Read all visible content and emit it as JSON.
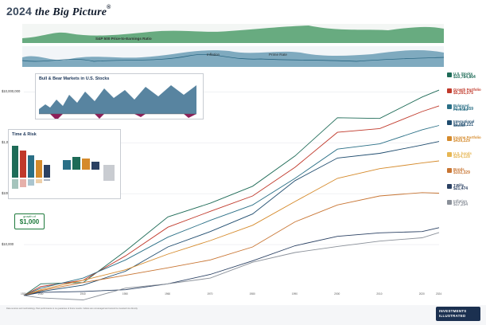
{
  "header": {
    "year": "2024",
    "brand": "the Big Picture",
    "reg": "®"
  },
  "bands": {
    "pe_title": "S&P 500 Price-to-Earnings Ratio",
    "inflation_title": "Inflation",
    "prime_title": "Prime Rate"
  },
  "y_axis": {
    "labels": [
      "$10,000,000",
      "$1,000,000",
      "$100,000",
      "$10,000"
    ]
  },
  "inset_bull": {
    "title": "Bull & Bear Markets in U.S. Stocks"
  },
  "inset_time": {
    "title": "Time & Risk"
  },
  "growth": {
    "label": "growth of",
    "value": "$1,000"
  },
  "legend": [
    {
      "name": "U.S. Stocks",
      "value": "$10,784,864",
      "color": "#1e6b57"
    },
    {
      "name": "Growth Portfolio",
      "value": "$5,291,075",
      "color": "#c0392b"
    },
    {
      "name": "Balanced Portfolio",
      "value": "$2,179,859",
      "color": "#2a6f86"
    },
    {
      "name": "International Stocks",
      "value": "$1,058,221",
      "color": "#1f4c6e"
    },
    {
      "name": "Income Portfolio",
      "value": "$439,229",
      "color": "#d58a2b"
    },
    {
      "name": "U.S. bonds",
      "value": "$254,128",
      "color": "#e6b653"
    },
    {
      "name": "Bonds",
      "value": "$102,329",
      "color": "#c87533"
    },
    {
      "name": "T-Bills",
      "value": "$21,474",
      "color": "#2b4163"
    },
    {
      "name": "Inflation",
      "value": "$17,254",
      "color": "#8a9099"
    }
  ],
  "logo": {
    "line1": "INVESTMENTS",
    "line2": "ILLUSTRATED"
  },
  "footnote": "Data sources and methodology. Past performance is no guarantee of future results. Indices are unmanaged and cannot be invested into directly.",
  "x_axis": {
    "years": [
      "1926",
      "1930",
      "1940",
      "1950",
      "1960",
      "1970",
      "1980",
      "1990",
      "2000",
      "2010",
      "2020",
      "2024"
    ]
  },
  "chart_data": {
    "type": "line",
    "title": "",
    "ylabel": "",
    "yscale": "log",
    "ylim": [
      1000,
      20000000
    ],
    "x": [
      1926,
      1930,
      1940,
      1950,
      1960,
      1970,
      1980,
      1990,
      2000,
      2010,
      2020,
      2024
    ],
    "series": [
      {
        "name": "U.S. Stocks",
        "values": [
          1000,
          1700,
          1800,
          7500,
          35000,
          65000,
          140000,
          550000,
          3100000,
          3000000,
          7900000,
          10784864
        ]
      },
      {
        "name": "Growth Portfolio",
        "values": [
          1000,
          1500,
          2000,
          6000,
          22000,
          45000,
          90000,
          330000,
          1600000,
          1900000,
          4100000,
          5291075
        ]
      },
      {
        "name": "Balanced Portfolio",
        "values": [
          1000,
          1400,
          2200,
          5000,
          14000,
          30000,
          60000,
          200000,
          750000,
          950000,
          1800000,
          2179859
        ]
      },
      {
        "name": "International Stocks",
        "values": [
          1000,
          1200,
          1600,
          3000,
          9000,
          18000,
          40000,
          180000,
          500000,
          620000,
          900000,
          1058221
        ]
      },
      {
        "name": "Income Portfolio",
        "values": [
          1000,
          1300,
          2000,
          3200,
          6500,
          12000,
          24000,
          70000,
          200000,
          310000,
          400000,
          439229
        ]
      },
      {
        "name": "Bonds",
        "values": [
          1000,
          1250,
          1800,
          2500,
          3500,
          5000,
          9000,
          28000,
          60000,
          90000,
          105000,
          102329
        ]
      },
      {
        "name": "T-Bills",
        "values": [
          1000,
          1150,
          1200,
          1300,
          1700,
          2600,
          4800,
          9500,
          14500,
          17000,
          18000,
          21474
        ]
      },
      {
        "name": "Inflation",
        "values": [
          1000,
          900,
          820,
          1400,
          1700,
          2200,
          4500,
          7000,
          9200,
          11700,
          13600,
          17254
        ]
      }
    ]
  }
}
